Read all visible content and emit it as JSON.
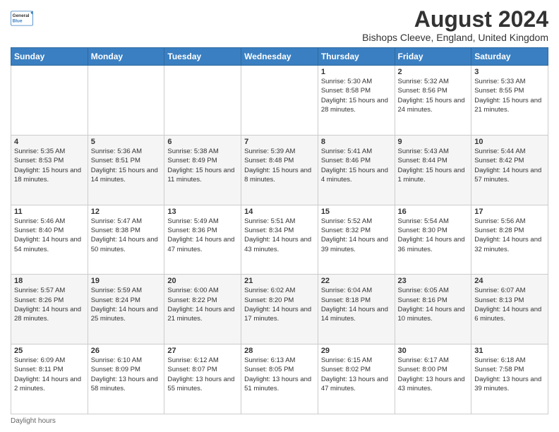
{
  "logo": {
    "general": "General",
    "blue": "Blue"
  },
  "header": {
    "month": "August 2024",
    "location": "Bishops Cleeve, England, United Kingdom"
  },
  "days_of_week": [
    "Sunday",
    "Monday",
    "Tuesday",
    "Wednesday",
    "Thursday",
    "Friday",
    "Saturday"
  ],
  "weeks": [
    [
      {
        "num": "",
        "info": ""
      },
      {
        "num": "",
        "info": ""
      },
      {
        "num": "",
        "info": ""
      },
      {
        "num": "",
        "info": ""
      },
      {
        "num": "1",
        "info": "Sunrise: 5:30 AM\nSunset: 8:58 PM\nDaylight: 15 hours and 28 minutes."
      },
      {
        "num": "2",
        "info": "Sunrise: 5:32 AM\nSunset: 8:56 PM\nDaylight: 15 hours and 24 minutes."
      },
      {
        "num": "3",
        "info": "Sunrise: 5:33 AM\nSunset: 8:55 PM\nDaylight: 15 hours and 21 minutes."
      }
    ],
    [
      {
        "num": "4",
        "info": "Sunrise: 5:35 AM\nSunset: 8:53 PM\nDaylight: 15 hours and 18 minutes."
      },
      {
        "num": "5",
        "info": "Sunrise: 5:36 AM\nSunset: 8:51 PM\nDaylight: 15 hours and 14 minutes."
      },
      {
        "num": "6",
        "info": "Sunrise: 5:38 AM\nSunset: 8:49 PM\nDaylight: 15 hours and 11 minutes."
      },
      {
        "num": "7",
        "info": "Sunrise: 5:39 AM\nSunset: 8:48 PM\nDaylight: 15 hours and 8 minutes."
      },
      {
        "num": "8",
        "info": "Sunrise: 5:41 AM\nSunset: 8:46 PM\nDaylight: 15 hours and 4 minutes."
      },
      {
        "num": "9",
        "info": "Sunrise: 5:43 AM\nSunset: 8:44 PM\nDaylight: 15 hours and 1 minute."
      },
      {
        "num": "10",
        "info": "Sunrise: 5:44 AM\nSunset: 8:42 PM\nDaylight: 14 hours and 57 minutes."
      }
    ],
    [
      {
        "num": "11",
        "info": "Sunrise: 5:46 AM\nSunset: 8:40 PM\nDaylight: 14 hours and 54 minutes."
      },
      {
        "num": "12",
        "info": "Sunrise: 5:47 AM\nSunset: 8:38 PM\nDaylight: 14 hours and 50 minutes."
      },
      {
        "num": "13",
        "info": "Sunrise: 5:49 AM\nSunset: 8:36 PM\nDaylight: 14 hours and 47 minutes."
      },
      {
        "num": "14",
        "info": "Sunrise: 5:51 AM\nSunset: 8:34 PM\nDaylight: 14 hours and 43 minutes."
      },
      {
        "num": "15",
        "info": "Sunrise: 5:52 AM\nSunset: 8:32 PM\nDaylight: 14 hours and 39 minutes."
      },
      {
        "num": "16",
        "info": "Sunrise: 5:54 AM\nSunset: 8:30 PM\nDaylight: 14 hours and 36 minutes."
      },
      {
        "num": "17",
        "info": "Sunrise: 5:56 AM\nSunset: 8:28 PM\nDaylight: 14 hours and 32 minutes."
      }
    ],
    [
      {
        "num": "18",
        "info": "Sunrise: 5:57 AM\nSunset: 8:26 PM\nDaylight: 14 hours and 28 minutes."
      },
      {
        "num": "19",
        "info": "Sunrise: 5:59 AM\nSunset: 8:24 PM\nDaylight: 14 hours and 25 minutes."
      },
      {
        "num": "20",
        "info": "Sunrise: 6:00 AM\nSunset: 8:22 PM\nDaylight: 14 hours and 21 minutes."
      },
      {
        "num": "21",
        "info": "Sunrise: 6:02 AM\nSunset: 8:20 PM\nDaylight: 14 hours and 17 minutes."
      },
      {
        "num": "22",
        "info": "Sunrise: 6:04 AM\nSunset: 8:18 PM\nDaylight: 14 hours and 14 minutes."
      },
      {
        "num": "23",
        "info": "Sunrise: 6:05 AM\nSunset: 8:16 PM\nDaylight: 14 hours and 10 minutes."
      },
      {
        "num": "24",
        "info": "Sunrise: 6:07 AM\nSunset: 8:13 PM\nDaylight: 14 hours and 6 minutes."
      }
    ],
    [
      {
        "num": "25",
        "info": "Sunrise: 6:09 AM\nSunset: 8:11 PM\nDaylight: 14 hours and 2 minutes."
      },
      {
        "num": "26",
        "info": "Sunrise: 6:10 AM\nSunset: 8:09 PM\nDaylight: 13 hours and 58 minutes."
      },
      {
        "num": "27",
        "info": "Sunrise: 6:12 AM\nSunset: 8:07 PM\nDaylight: 13 hours and 55 minutes."
      },
      {
        "num": "28",
        "info": "Sunrise: 6:13 AM\nSunset: 8:05 PM\nDaylight: 13 hours and 51 minutes."
      },
      {
        "num": "29",
        "info": "Sunrise: 6:15 AM\nSunset: 8:02 PM\nDaylight: 13 hours and 47 minutes."
      },
      {
        "num": "30",
        "info": "Sunrise: 6:17 AM\nSunset: 8:00 PM\nDaylight: 13 hours and 43 minutes."
      },
      {
        "num": "31",
        "info": "Sunrise: 6:18 AM\nSunset: 7:58 PM\nDaylight: 13 hours and 39 minutes."
      }
    ]
  ],
  "footer": "Daylight hours"
}
